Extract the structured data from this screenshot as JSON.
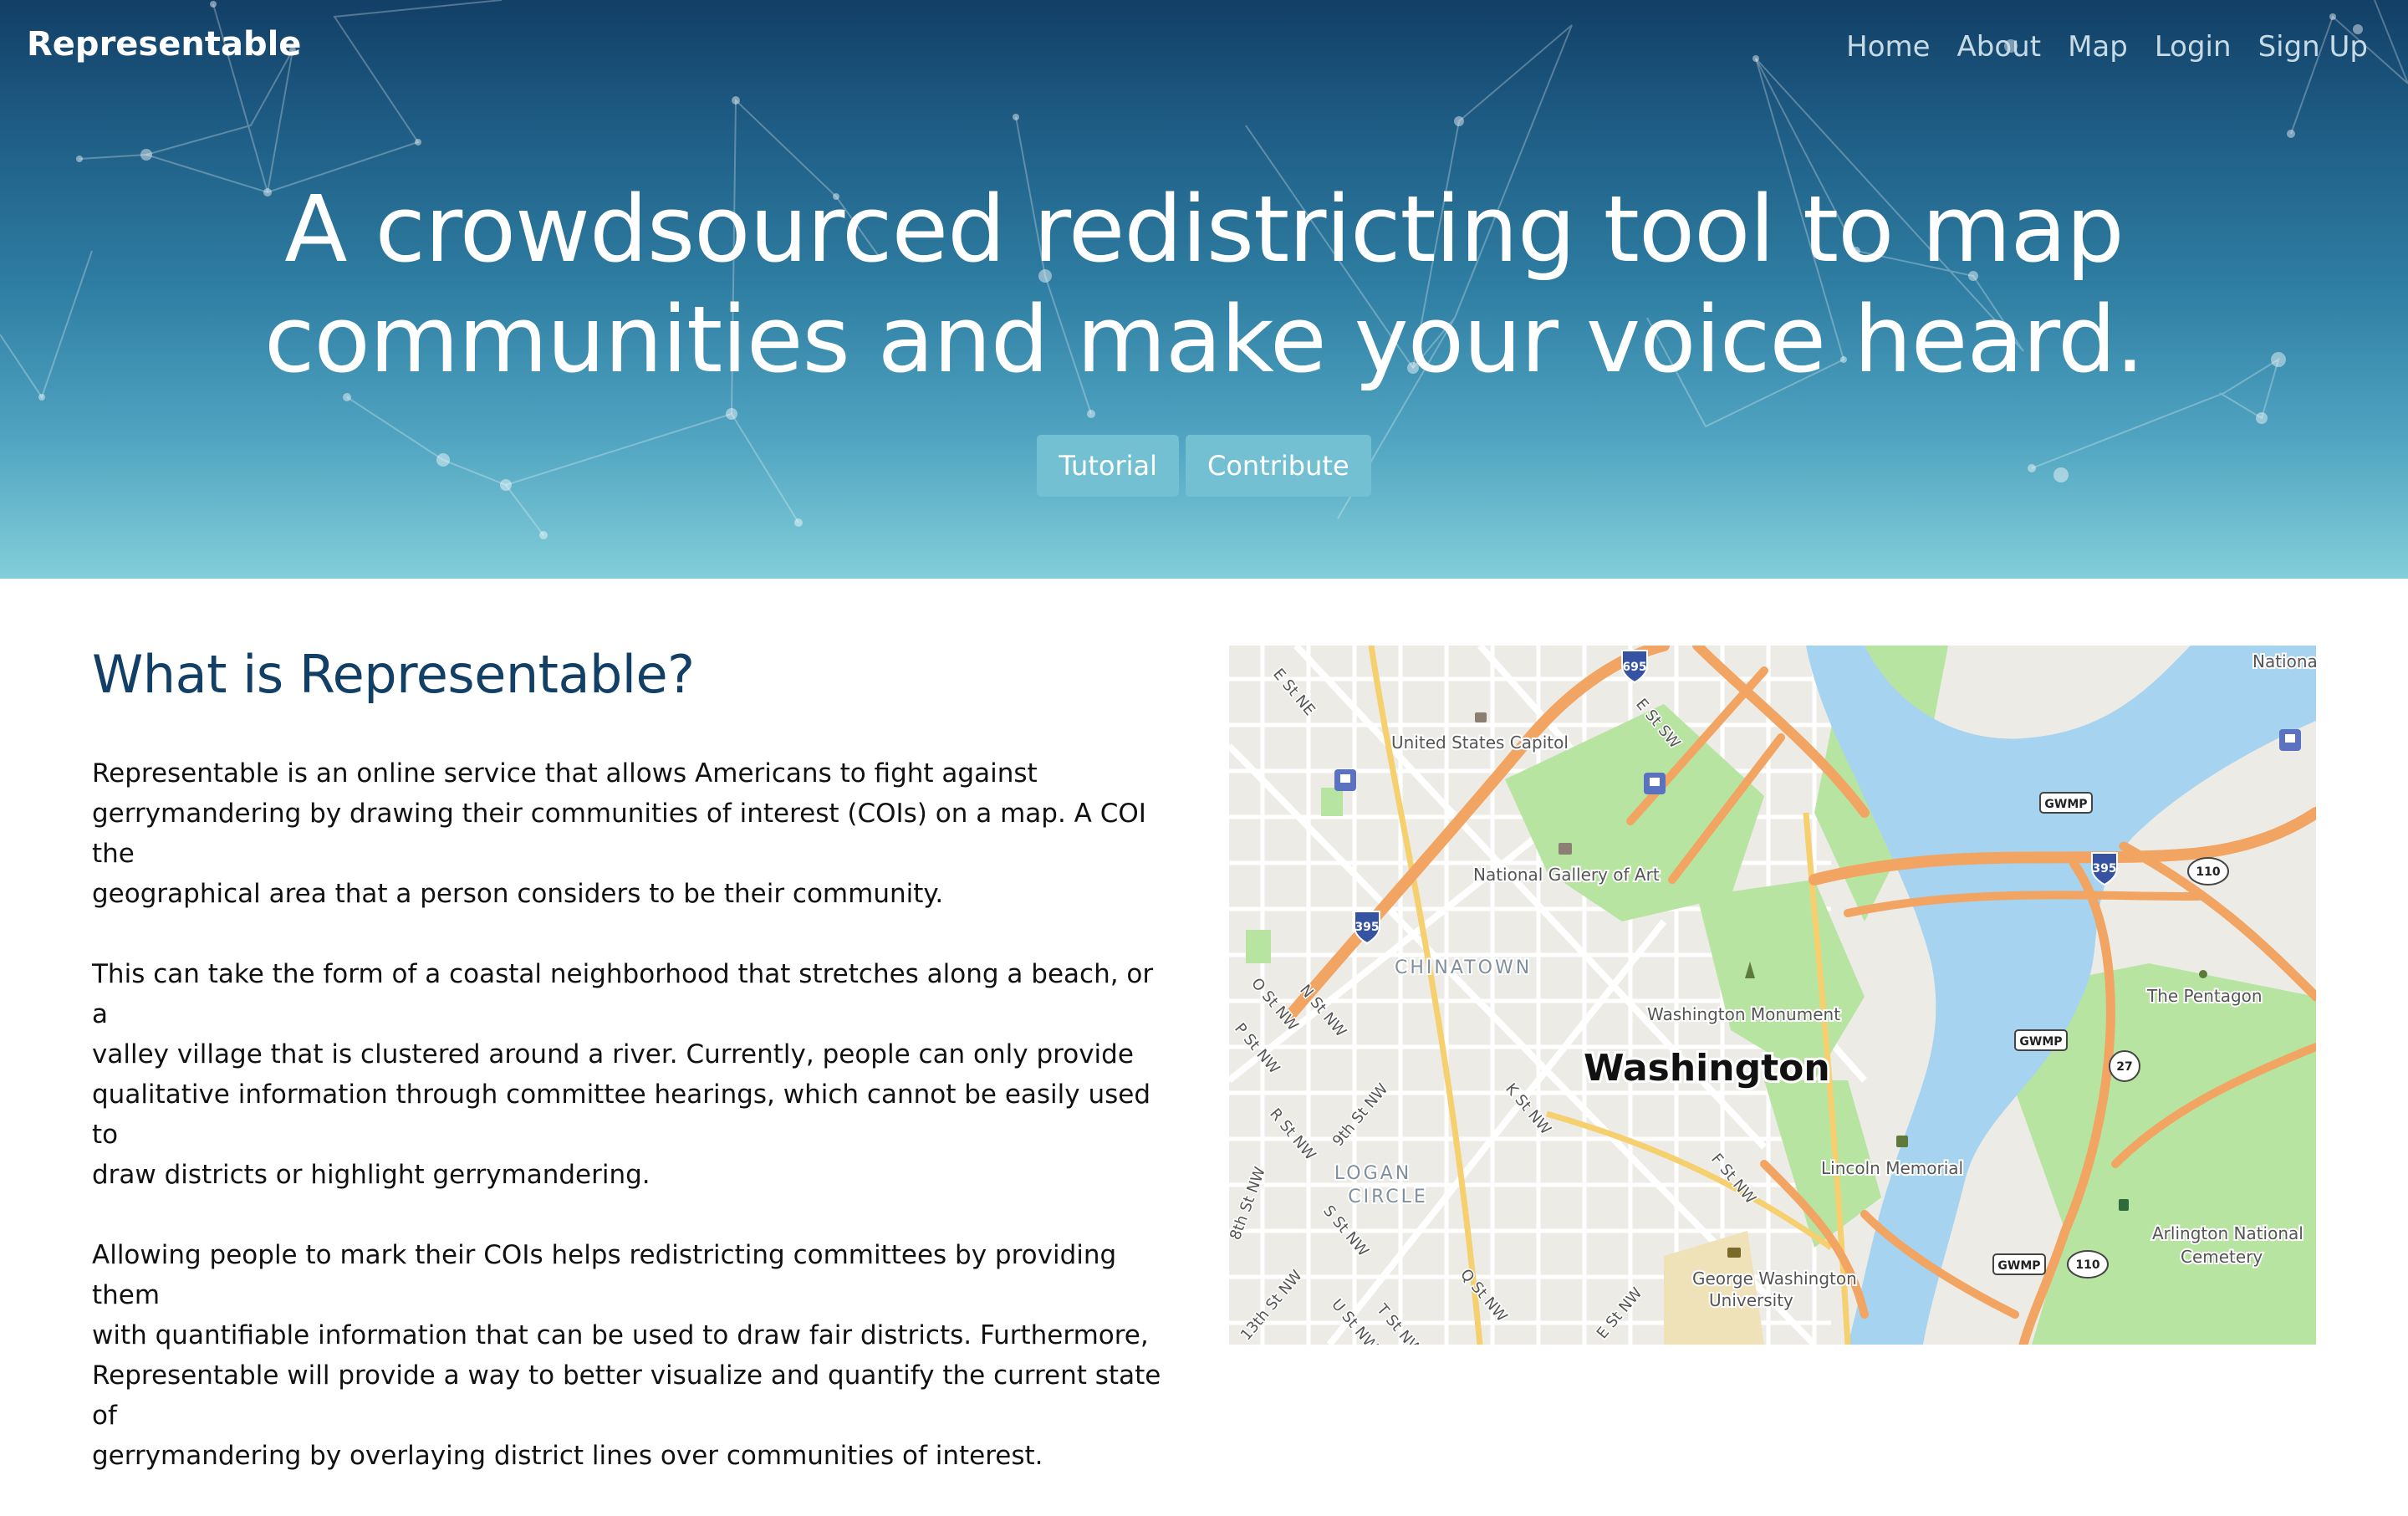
{
  "header": {
    "brand": "Representable",
    "nav": [
      "Home",
      "About",
      "Map",
      "Login",
      "Sign Up"
    ]
  },
  "hero": {
    "headline_line1": "A crowdsourced redistricting tool to map",
    "headline_line2": "communities and make your voice heard.",
    "buttons": [
      "Tutorial",
      "Contribute"
    ]
  },
  "about": {
    "heading": "What is Representable?",
    "paragraphs": [
      [
        "Representable is an online service that allows Americans to fight against",
        "gerrymandering by drawing their communities of interest (COIs) on a map. A COI the",
        "geographical area that a person considers to be their community."
      ],
      [
        "This can take the form of a coastal neighborhood that stretches along a beach, or a",
        "valley village that is clustered around a river. Currently, people can only provide",
        "qualitative information through committee hearings, which cannot be easily used to",
        "draw districts or highlight gerrymandering."
      ],
      [
        "Allowing people to mark their COIs helps redistricting committees by providing them",
        "with quantifiable information that can be used to draw fair districts. Furthermore,",
        "Representable will provide a way to better visualize and quantify the current state of",
        "gerrymandering by overlaying district lines over communities of interest."
      ]
    ]
  },
  "map": {
    "city": "Washington",
    "places": [
      "United States Capitol",
      "National Gallery of Art",
      "CHINATOWN",
      "Washington Monument",
      "Lincoln Memorial",
      "LOGAN",
      "CIRCLE",
      "George Washington",
      "University",
      "The Pentagon",
      "Arlington National",
      "Cemetery",
      "Nationa"
    ],
    "streets": [
      "E St NE",
      "E St SW",
      "O St NW",
      "N St NW",
      "P St NW",
      "R St NW",
      "9th St NW",
      "K St NW",
      "S St NW",
      "Q St NW",
      "F St NW",
      "U St NW",
      "T St NW",
      "13th St NW",
      "8th St NW",
      "E St NW"
    ],
    "shields": [
      "695",
      "395",
      "395",
      "GWMP",
      "110",
      "GWMP",
      "27",
      "GWMP",
      "110"
    ],
    "colors": {
      "water": "#a6d3f0",
      "park": "#b8e4a2",
      "highway": "#f2a462",
      "major_road": "#f6cf6e",
      "land": "#ecebe6",
      "road": "#ffffff"
    }
  }
}
